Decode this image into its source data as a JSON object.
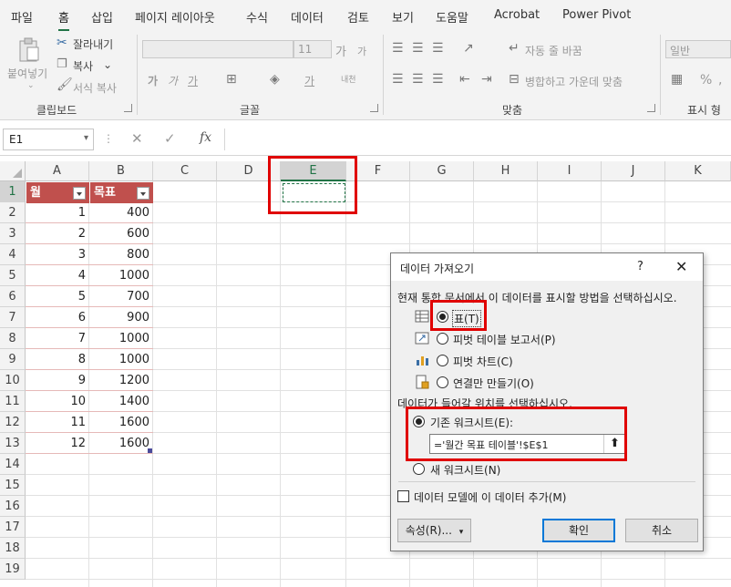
{
  "ribbon_tabs": [
    "파일",
    "홈",
    "삽입",
    "페이지 레이아웃",
    "수식",
    "데이터",
    "검토",
    "보기",
    "도움말",
    "Acrobat",
    "Power Pivot"
  ],
  "ribbon": {
    "clipboard": {
      "paste": "붙여넣기",
      "cut": "잘라내기",
      "copy": "복사",
      "format_painter": "서식 복사",
      "label": "클립보드"
    },
    "font": {
      "size": "11",
      "label": "글꼴",
      "bold": "가",
      "italic": "가",
      "underline": "가",
      "grow": "가",
      "shrink": "가",
      "font_color": "가",
      "phonetic": "내천"
    },
    "alignment": {
      "wrap": "자동 줄 바꿈",
      "merge": "병합하고 가운데 맞춤",
      "label": "맞춤"
    },
    "number": {
      "format": "일반",
      "label": "표시 형"
    }
  },
  "formula_bar": {
    "name_box": "E1",
    "fx": "fx",
    "formula": ""
  },
  "columns": [
    "A",
    "B",
    "C",
    "D",
    "E",
    "F",
    "G",
    "H",
    "I",
    "J",
    "K"
  ],
  "rows": [
    "1",
    "2",
    "3",
    "4",
    "5",
    "6",
    "7",
    "8",
    "9",
    "10",
    "11",
    "12",
    "13",
    "14",
    "15",
    "16",
    "17",
    "18",
    "19"
  ],
  "table": {
    "headers": [
      "월",
      "목표"
    ],
    "rows": [
      [
        "1",
        "400"
      ],
      [
        "2",
        "600"
      ],
      [
        "3",
        "800"
      ],
      [
        "4",
        "1000"
      ],
      [
        "5",
        "700"
      ],
      [
        "6",
        "900"
      ],
      [
        "7",
        "1000"
      ],
      [
        "8",
        "1000"
      ],
      [
        "9",
        "1200"
      ],
      [
        "10",
        "1400"
      ],
      [
        "11",
        "1600"
      ],
      [
        "12",
        "1600"
      ]
    ]
  },
  "dialog": {
    "title": "데이터 가져오기",
    "help": "?",
    "close": "✕",
    "prompt_view": "현재 통합 문서에서 이 데이터를 표시할 방법을 선택하십시오.",
    "options": [
      "표(T)",
      "피벗 테이블 보고서(P)",
      "피벗 차트(C)",
      "연결만 만들기(O)"
    ],
    "selected_option": "표(T)",
    "prompt_location": "데이터가 들어갈 위치를 선택하십시오.",
    "existing_sheet": "기존 워크시트(E):",
    "location_value": "='월간 목표 테이블'!$E$1",
    "new_sheet": "새 워크시트(N)",
    "add_to_model": "데이터 모델에 이 데이터 추가(M)",
    "properties_button": "속성(R)...",
    "ok_button": "확인",
    "cancel_button": "취소"
  }
}
